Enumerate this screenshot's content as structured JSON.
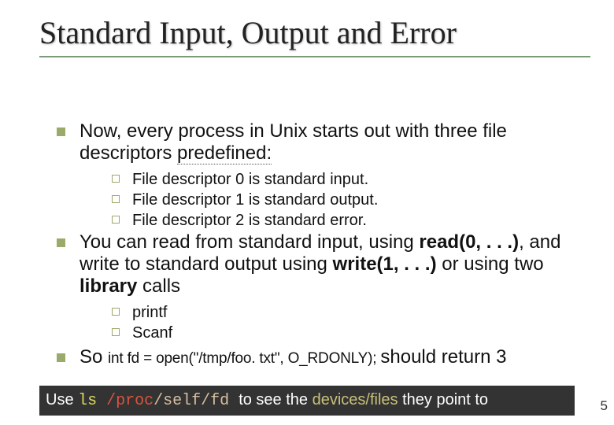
{
  "title": "Standard Input, Output and Error",
  "bullets": {
    "intro": {
      "pre": "Now, every process in Unix starts out with three file descriptors ",
      "pred": "predefined:"
    },
    "fd0": "File descriptor 0 is standard input.",
    "fd1": "File descriptor 1 is standard output.",
    "fd2": "File descriptor 2 is standard error.",
    "rw": {
      "p1": "You can read from standard input, using ",
      "r": "read(0, . . .)",
      "p2": ", and write to standard output using ",
      "w": "write(1, . . .)",
      "p3": " or using two ",
      "lib": "library",
      "p4": " calls"
    },
    "printf": "printf",
    "scanf": "Scanf",
    "so": {
      "big": "So ",
      "small": "int fd = open(\"/tmp/foo. txt\", O_RDONLY); ",
      "tail": "should return 3"
    }
  },
  "footer": {
    "p1": "Use ",
    "ls": "ls ",
    "proc": "/proc",
    "rest": "/self/fd ",
    "p2": "to see the ",
    "devfiles": "devices/files ",
    "p3": "they point to"
  },
  "page_num": "5"
}
